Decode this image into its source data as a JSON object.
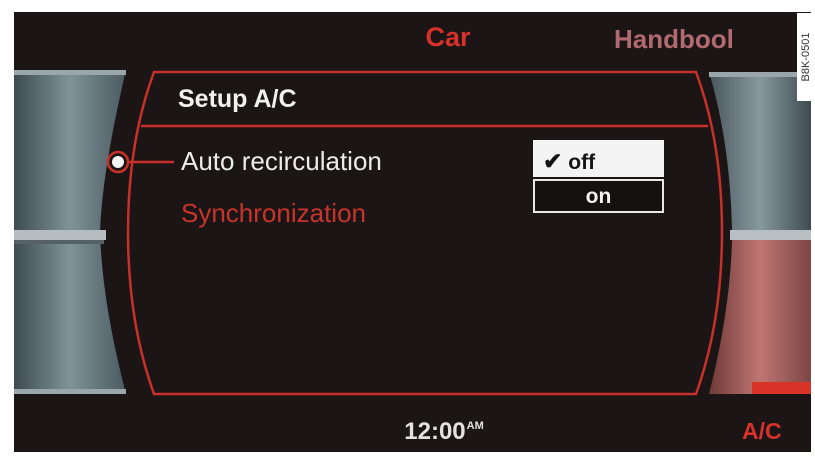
{
  "header": {
    "left_label": "Car",
    "right_label": "Handbool"
  },
  "menu": {
    "title": "Setup A/C",
    "items": [
      {
        "label": "Auto recirculation",
        "selected": true
      },
      {
        "label": "Synchronization",
        "selected": false
      }
    ]
  },
  "options": [
    {
      "label": "off",
      "checked": true
    },
    {
      "label": "on",
      "checked": false
    }
  ],
  "status": {
    "time": "12:00",
    "time_suffix": "AM",
    "right_label": "A/C"
  },
  "image_code": "B8K-0501",
  "colors": {
    "accent_red": "#d8302a",
    "background": "#1b1615",
    "text": "#ececec"
  },
  "icons": {
    "selection": "radio-dot-icon",
    "check": "check-icon"
  }
}
